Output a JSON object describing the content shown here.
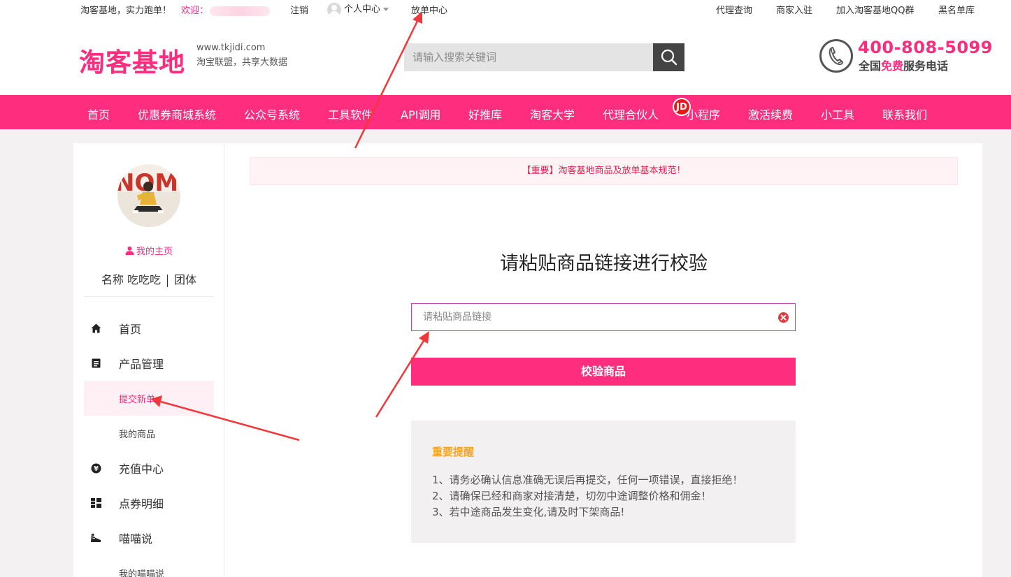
{
  "topbar": {
    "slogan": "淘客基地，实力跑单！",
    "welcome": "欢迎：",
    "logout": "注销",
    "personal_center": "个人中心",
    "order_center": "放单中心",
    "agent_query": "代理查询",
    "merchant_join": "商家入驻",
    "join_qq": "加入淘客基地QQ群",
    "blacklist": "黑名单库"
  },
  "header": {
    "logo": "淘客基地",
    "site_url": "www.tkjidi.com",
    "site_tagline": "淘宝联盟，共享大数据",
    "search_placeholder": "请输入搜索关键词",
    "phone_number": "400-808-5099",
    "phone_sub_prefix": "全国",
    "phone_sub_free": "免费",
    "phone_sub_suffix": "服务电话"
  },
  "nav": {
    "items": [
      "首页",
      "优惠券商城系统",
      "公众号系统",
      "工具软件",
      "API调用",
      "好推库",
      "淘客大学",
      "代理合伙人",
      "小程序",
      "激活续费",
      "小工具",
      "联系我们"
    ],
    "badge": "JD"
  },
  "sidebar": {
    "my_home": "我的主页",
    "name_label": "名称 吃吃吃",
    "group": "团体",
    "menu": {
      "home": "首页",
      "product_mgmt": "产品管理",
      "submit_new": "提交新单",
      "my_products": "我的商品",
      "recharge": "充值中心",
      "coupon_detail": "点券明细",
      "miaomiao": "喵喵说",
      "my_miaomiao": "我的喵喵说"
    }
  },
  "main": {
    "notice": "【重要】淘客基地商品及放单基本规范！",
    "title": "请粘贴商品链接进行校验",
    "link_placeholder": "请粘贴商品链接",
    "verify_button": "校验商品",
    "reminder_title": "重要提醒",
    "reminder_lines": [
      "1、请务必确认信息准确无误后再提交，任何一项错误，直接拒绝！",
      "2、请确保已经和商家对接清楚，切勿中途调整价格和佣金！",
      "3、若中途商品发生变化,请及时下架商品!"
    ]
  },
  "colors": {
    "brand_pink": "#ff2d7e",
    "notice_red": "#e5214f",
    "reminder_orange": "#f3a52b",
    "arrow_red": "#f0383a"
  }
}
